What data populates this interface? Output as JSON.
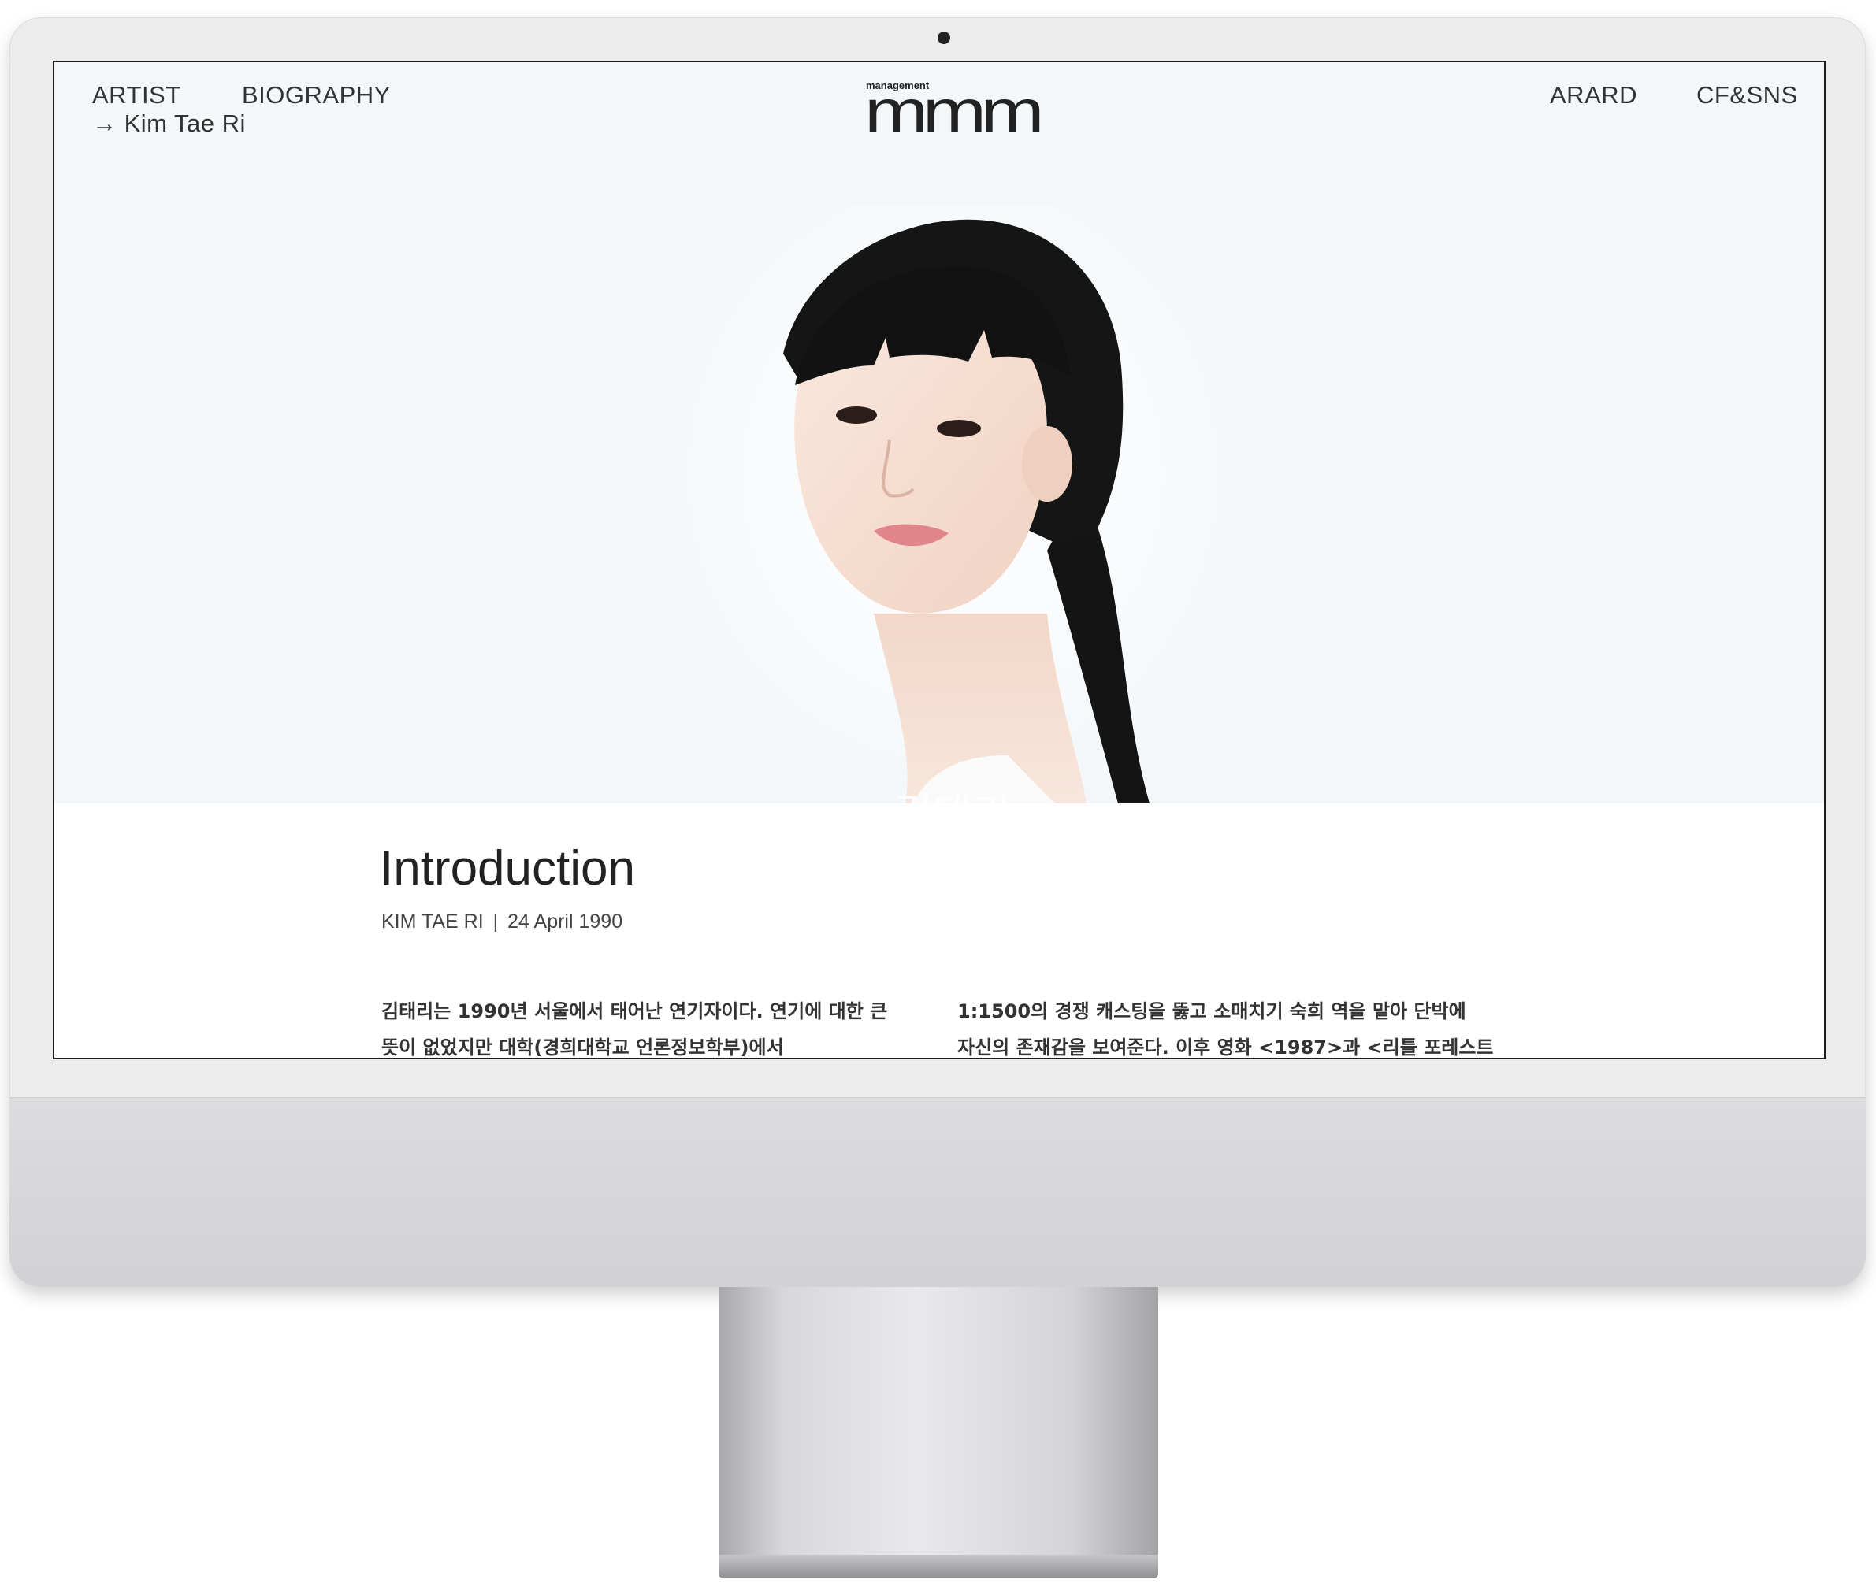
{
  "nav": {
    "artist": "ARTIST",
    "artist_sub": "→ Kim Tae Ri",
    "biography": "BIOGRAPHY",
    "award": "ARARD",
    "cf_sns": "CF&SNS"
  },
  "logo": {
    "small": "management",
    "main": "mmm"
  },
  "hero": {
    "name_kr": "김태리",
    "name_en": "KIM TAE RI"
  },
  "intro": {
    "title": "Introduction",
    "name": "KIM TAE RI",
    "separator": "|",
    "birth": "24 April 1990",
    "left_lines": [
      "김태리는 1990년 서울에서 태어난 연기자이다. 연기에 대한 큰",
      "뜻이 없었지만 대학(경희대학교 언론정보학부)에서"
    ],
    "right_lines": [
      "1:1500의 경쟁 캐스팅을 뚫고 소매치기 숙희 역을 맡아 단박에",
      "자신의 존재감을 보여준다. 이후 영화 <1987>과 <리틀 포레스트"
    ]
  }
}
